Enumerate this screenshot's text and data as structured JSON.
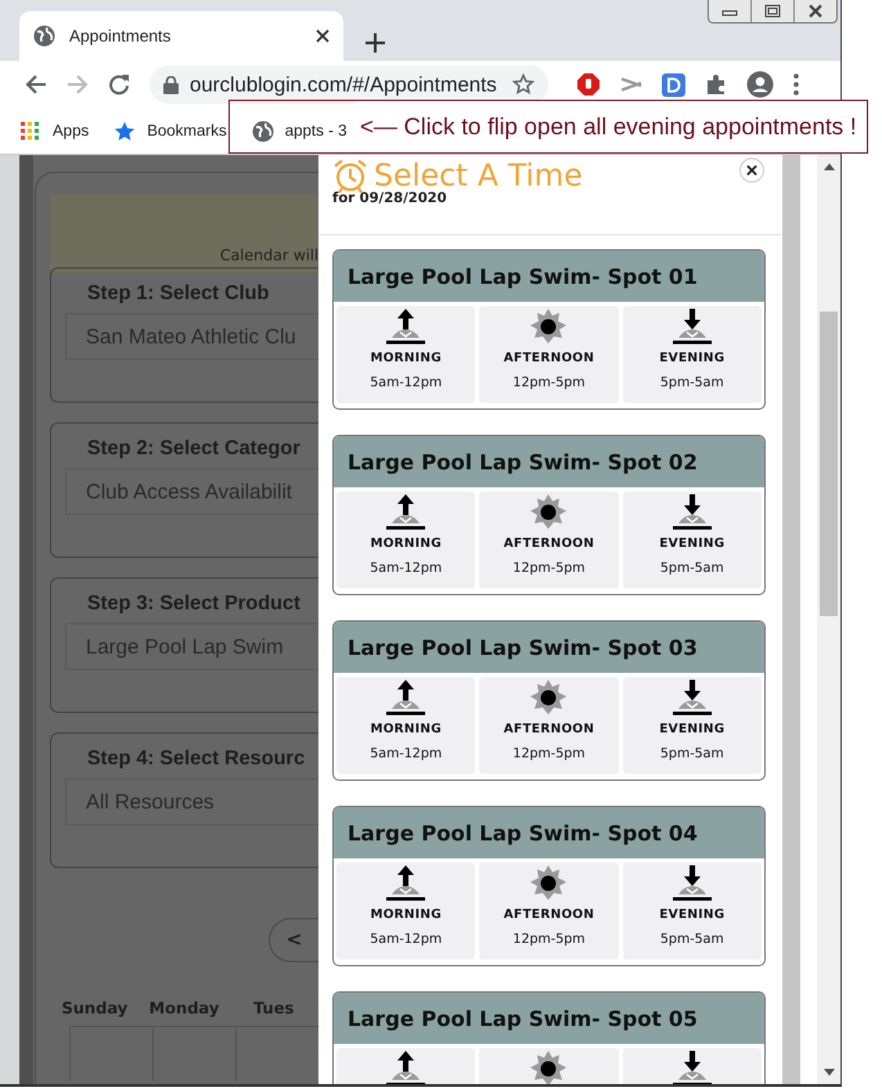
{
  "browser": {
    "tab_title": "Appointments",
    "url": "ourclublogin.com/#/Appointments",
    "bookmarks": [
      {
        "kind": "apps",
        "label": "Apps"
      },
      {
        "kind": "star",
        "label": "Bookmarks"
      },
      {
        "kind": "globe",
        "label": "appts - 3"
      }
    ]
  },
  "annotation": "<— Click to flip open all evening appointments !",
  "background_page": {
    "notice": "Calendar will",
    "steps": [
      {
        "title": "Step 1: Select Club",
        "value": "San Mateo Athletic Clu"
      },
      {
        "title": "Step 2: Select Categor",
        "value": "Club Access Availabilit"
      },
      {
        "title": "Step 3: Select Product",
        "value": "Large Pool Lap Swim"
      },
      {
        "title": "Step 4: Select Resourc",
        "value": "All Resources"
      }
    ],
    "pager": "<",
    "weekdays": [
      "Sunday",
      "Monday",
      "Tues"
    ]
  },
  "modal": {
    "title": "Select A Time",
    "date": "for 09/28/2020",
    "close": "×",
    "resources": [
      {
        "name": "Large Pool Lap Swim- Spot 01",
        "periods": [
          {
            "kind": "morning",
            "label": "MORNING",
            "hours": "5am-12pm"
          },
          {
            "kind": "afternoon",
            "label": "AFTERNOON",
            "hours": "12pm-5pm"
          },
          {
            "kind": "evening",
            "label": "EVENING",
            "hours": "5pm-5am"
          }
        ]
      },
      {
        "name": "Large Pool Lap Swim- Spot 02",
        "periods": [
          {
            "kind": "morning",
            "label": "MORNING",
            "hours": "5am-12pm"
          },
          {
            "kind": "afternoon",
            "label": "AFTERNOON",
            "hours": "12pm-5pm"
          },
          {
            "kind": "evening",
            "label": "EVENING",
            "hours": "5pm-5am"
          }
        ]
      },
      {
        "name": "Large Pool Lap Swim- Spot 03",
        "periods": [
          {
            "kind": "morning",
            "label": "MORNING",
            "hours": "5am-12pm"
          },
          {
            "kind": "afternoon",
            "label": "AFTERNOON",
            "hours": "12pm-5pm"
          },
          {
            "kind": "evening",
            "label": "EVENING",
            "hours": "5pm-5am"
          }
        ]
      },
      {
        "name": "Large Pool Lap Swim- Spot 04",
        "periods": [
          {
            "kind": "morning",
            "label": "MORNING",
            "hours": "5am-12pm"
          },
          {
            "kind": "afternoon",
            "label": "AFTERNOON",
            "hours": "12pm-5pm"
          },
          {
            "kind": "evening",
            "label": "EVENING",
            "hours": "5pm-5am"
          }
        ]
      },
      {
        "name": "Large Pool Lap Swim- Spot 05",
        "periods": [
          {
            "kind": "morning"
          },
          {
            "kind": "afternoon"
          },
          {
            "kind": "evening"
          }
        ]
      }
    ]
  }
}
